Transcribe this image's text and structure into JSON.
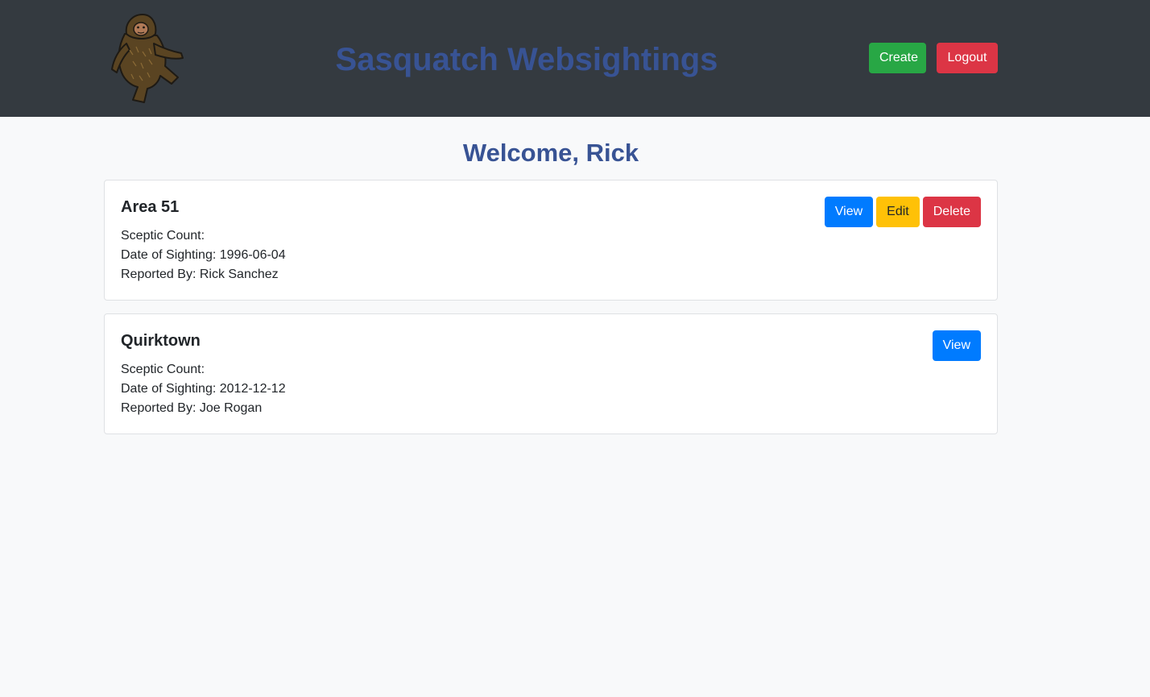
{
  "navbar": {
    "title": "Sasquatch Websightings",
    "create_label": "Create",
    "logout_label": "Logout"
  },
  "main": {
    "welcome": "Welcome, Rick"
  },
  "sightings": [
    {
      "location": "Area 51",
      "sceptic_label": "Sceptic Count:",
      "date_label": "Date of Sighting: 1996-06-04",
      "reporter_label": "Reported By: Rick Sanchez",
      "actions": {
        "view": "View",
        "edit": "Edit",
        "delete": "Delete"
      }
    },
    {
      "location": "Quirktown",
      "sceptic_label": "Sceptic Count:",
      "date_label": "Date of Sighting: 2012-12-12",
      "reporter_label": "Reported By: Joe Rogan",
      "actions": {
        "view": "View"
      }
    }
  ],
  "colors": {
    "navbar_bg": "#343a40",
    "title": "#385394",
    "success": "#28a745",
    "danger": "#dc3545",
    "primary": "#007bff",
    "warning": "#ffc107"
  },
  "icons": {
    "logo": "sasquatch-logo-icon"
  }
}
